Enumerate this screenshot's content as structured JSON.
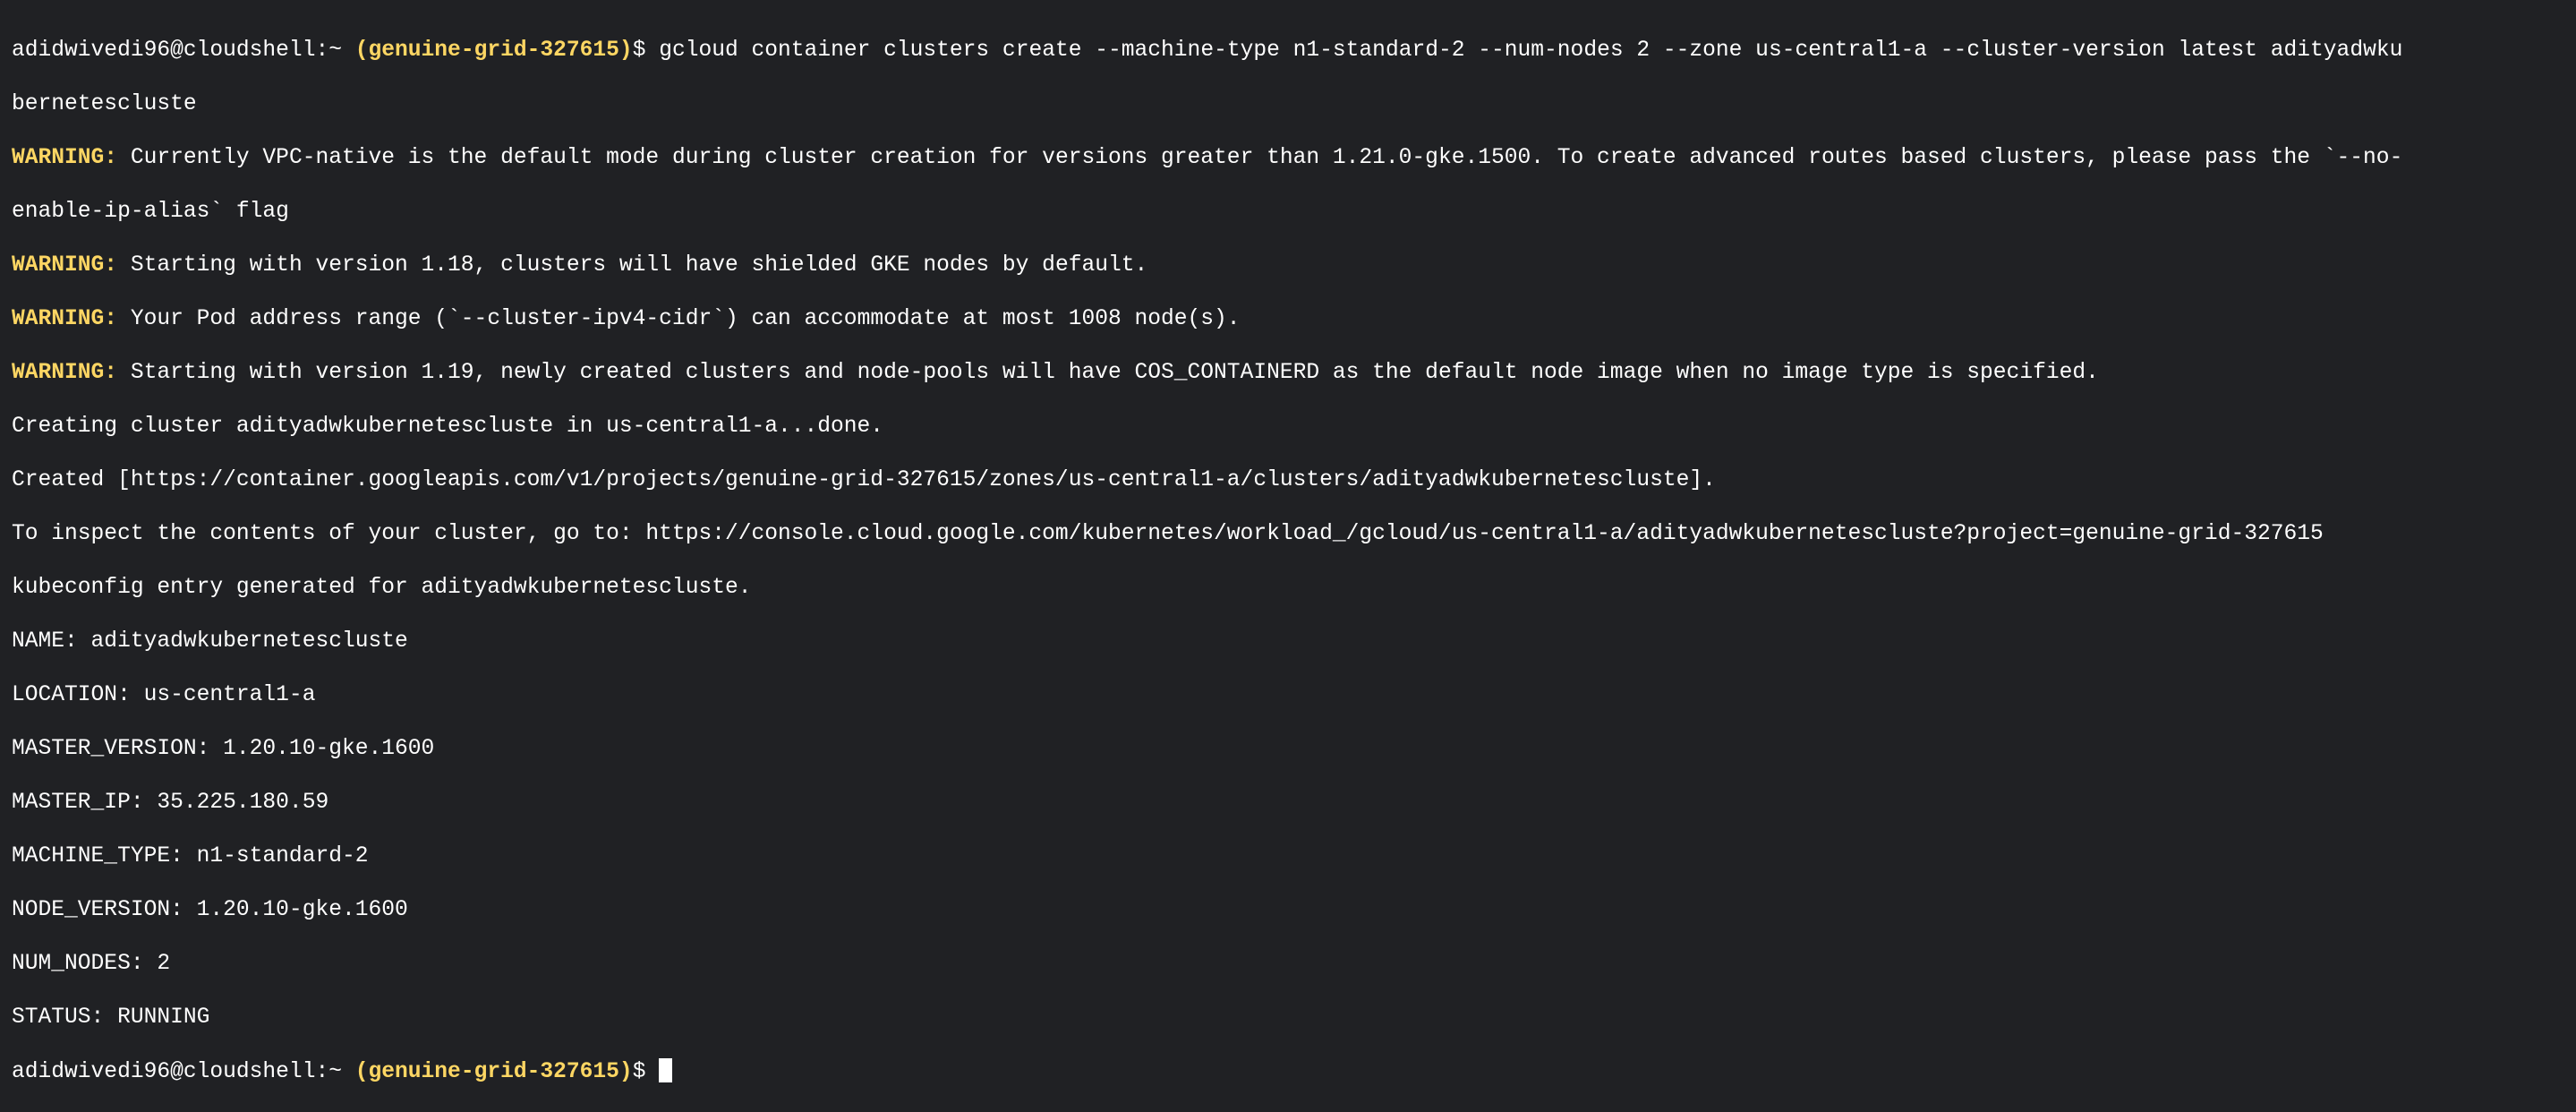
{
  "prompt": {
    "user_host": "adidwivedi96@cloudshell",
    "separator": ":",
    "path": "~",
    "project": "(genuine-grid-327615)",
    "symbol": "$"
  },
  "command": {
    "line1": " gcloud container clusters create --machine-type n1-standard-2 --num-nodes 2 --zone us-central1-a --cluster-version latest adityadwku",
    "line2": "bernetescluste"
  },
  "output": {
    "warn_label": "WARNING:",
    "warn1_line1": " Currently VPC-native is the default mode during cluster creation for versions greater than 1.21.0-gke.1500. To create advanced routes based clusters, please pass the `--no-",
    "warn1_line2": "enable-ip-alias` flag",
    "warn2": " Starting with version 1.18, clusters will have shielded GKE nodes by default.",
    "warn3": " Your Pod address range (`--cluster-ipv4-cidr`) can accommodate at most 1008 node(s).",
    "warn4": " Starting with version 1.19, newly created clusters and node-pools will have COS_CONTAINERD as the default node image when no image type is specified.",
    "creating": "Creating cluster adityadwkubernetescluste in us-central1-a...done.",
    "created": "Created [https://container.googleapis.com/v1/projects/genuine-grid-327615/zones/us-central1-a/clusters/adityadwkubernetescluste].",
    "inspect": "To inspect the contents of your cluster, go to: https://console.cloud.google.com/kubernetes/workload_/gcloud/us-central1-a/adityadwkubernetescluste?project=genuine-grid-327615",
    "kubeconfig": "kubeconfig entry generated for adityadwkubernetescluste.",
    "name": "NAME: adityadwkubernetescluste",
    "location": "LOCATION: us-central1-a",
    "master_version": "MASTER_VERSION: 1.20.10-gke.1600",
    "master_ip": "MASTER_IP: 35.225.180.59",
    "machine_type": "MACHINE_TYPE: n1-standard-2",
    "node_version": "NODE_VERSION: 1.20.10-gke.1600",
    "num_nodes": "NUM_NODES: 2",
    "status": "STATUS: RUNNING"
  },
  "colors": {
    "background": "#202124",
    "text": "#ffffff",
    "highlight": "#fdd663"
  }
}
